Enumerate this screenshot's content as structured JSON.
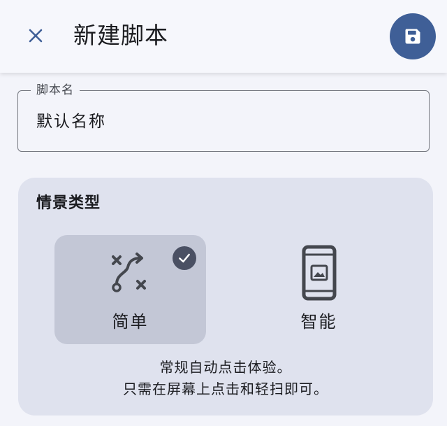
{
  "header": {
    "title": "新建脚本",
    "close_icon": "close-icon",
    "save_icon": "save-icon",
    "accent_color": "#3f5f97"
  },
  "name_field": {
    "label": "脚本名",
    "value": "默认名称"
  },
  "scenario": {
    "title": "情景类型",
    "options": [
      {
        "label": "简单",
        "icon": "route-icon",
        "selected": true
      },
      {
        "label": "智能",
        "icon": "phone-image-icon",
        "selected": false
      }
    ],
    "description": [
      "常规自动点击体验。",
      "只需在屏幕上点击和轻扫即可。"
    ]
  }
}
